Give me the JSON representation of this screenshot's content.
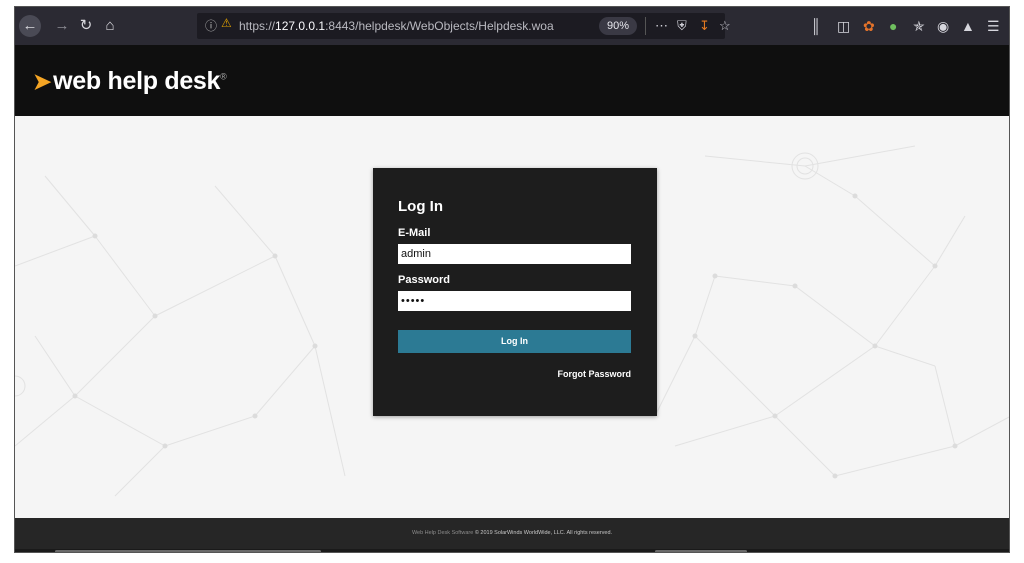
{
  "browser": {
    "url_scheme": "https://",
    "url_host": "127.0.0.1",
    "url_rest": ":8443/helpdesk/WebObjects/Helpdesk.woa",
    "zoom": "90%",
    "icons": [
      "back-icon",
      "forward-icon",
      "reload-icon",
      "home-icon",
      "info-icon",
      "insecure-lock-icon",
      "more-icon",
      "pocket-icon",
      "download-icon",
      "bookmark-star-icon",
      "library-icon",
      "sidebar-icon",
      "extension-icon",
      "extension-icon",
      "extension-icon",
      "account-icon",
      "extension-icon",
      "menu-icon"
    ]
  },
  "header": {
    "logo_text": "web help desk",
    "logo_mark": "registered-mark"
  },
  "login": {
    "title": "Log In",
    "email_label": "E-Mail",
    "email_value": "admin",
    "password_label": "Password",
    "password_value": "•••••",
    "submit_label": "Log In",
    "forgot_label": "Forgot Password"
  },
  "footer": {
    "product": "Web Help Desk Software",
    "copyright": "© 2019 SolarWinds WorldWide, LLC. All rights reserved."
  },
  "colors": {
    "accent_button": "#2c7a94",
    "logo_mark": "#f5a524",
    "header_bg": "#0f0f0f",
    "card_bg": "#1d1d1d"
  }
}
